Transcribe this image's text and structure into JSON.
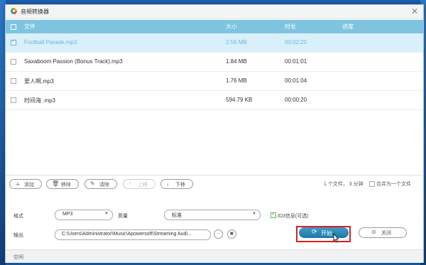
{
  "window": {
    "title": "音频转换器",
    "close_icon": "close-icon"
  },
  "table": {
    "headers": [
      "文件",
      "大小",
      "时长",
      "进度"
    ],
    "rows": [
      {
        "name": "Football Parade.mp3",
        "size": "2.56 MB",
        "duration": "00:02:20",
        "progress": "",
        "selected": true
      },
      {
        "name": "Saxaboom Passion (Bonus Track).mp3",
        "size": "1.84 MB",
        "duration": "00:01:01",
        "progress": "",
        "selected": false
      },
      {
        "name": "爱人啊.mp3",
        "size": "1.76 MB",
        "duration": "00:01:04",
        "progress": "",
        "selected": false
      },
      {
        "name": "时间海 .mp3",
        "size": "594.79 KB",
        "duration": "00:00:20",
        "progress": "",
        "selected": false
      }
    ]
  },
  "toolbar": {
    "add": "添加",
    "remove": "移除",
    "clear": "清除",
    "up": "上移",
    "down": "下移"
  },
  "summary": "1 个文件， 3 分钟",
  "merge_label": "合并为一个文件",
  "settings": {
    "format_label": "格式",
    "format_value": "MP3",
    "quality_label": "质量",
    "quality_value": "标准",
    "id3_label": "ID3信息(可选)",
    "id3_checked": true,
    "output_label": "输出",
    "output_path": "C:\\Users\\Administrator\\Music\\Apowersoft\\Streaming Audi..."
  },
  "buttons": {
    "start": "开始",
    "close": "关闭"
  },
  "status": "空闲",
  "colors": {
    "header": "#7ec4e0",
    "selected_row": "#d9f0fa",
    "start_button": "#2b87b8",
    "highlight_frame": "#d42222"
  }
}
